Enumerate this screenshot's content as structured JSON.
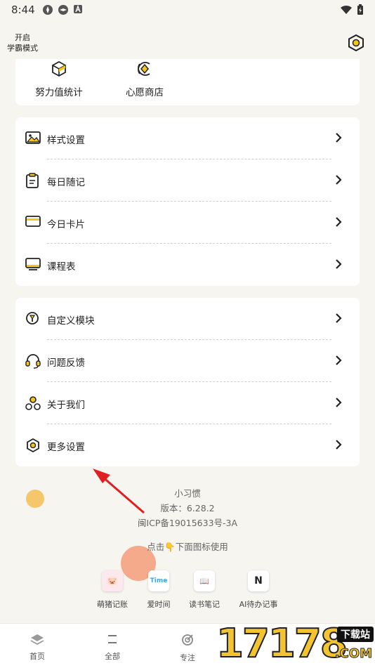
{
  "status_bar": {
    "time": "8:44"
  },
  "header": {
    "study_mode_line1": "开启",
    "study_mode_line2": "学霸模式"
  },
  "top_card": {
    "items": [
      {
        "label": "努力值统计"
      },
      {
        "label": "心愿商店"
      }
    ]
  },
  "menu_group_1": {
    "items": [
      {
        "label": "样式设置"
      },
      {
        "label": "每日随记"
      },
      {
        "label": "今日卡片"
      },
      {
        "label": "课程表"
      }
    ]
  },
  "menu_group_2": {
    "items": [
      {
        "label": "自定义模块"
      },
      {
        "label": "问题反馈"
      },
      {
        "label": "关于我们"
      },
      {
        "label": "更多设置"
      }
    ]
  },
  "footer": {
    "app_name": "小习惯",
    "version": "版本：6.28.2",
    "icp": "闽ICP备19015633号-3A",
    "hint": "点击👇下面图标使用"
  },
  "apps": [
    {
      "label": "萌猪记账",
      "icon_text": "🐷"
    },
    {
      "label": "爱时间",
      "icon_text": "Time"
    },
    {
      "label": "读书笔记",
      "icon_text": "📖"
    },
    {
      "label": "AI待办记事",
      "icon_text": "N"
    }
  ],
  "tabs": [
    {
      "label": "首页"
    },
    {
      "label": "全部"
    },
    {
      "label": "专注"
    }
  ],
  "watermark": {
    "digits": "17178",
    "label": "下载站",
    "suffix": ".COM"
  },
  "colors": {
    "accent": "#f5c518",
    "background": "#f6f5f0",
    "arrow": "#e02020"
  }
}
